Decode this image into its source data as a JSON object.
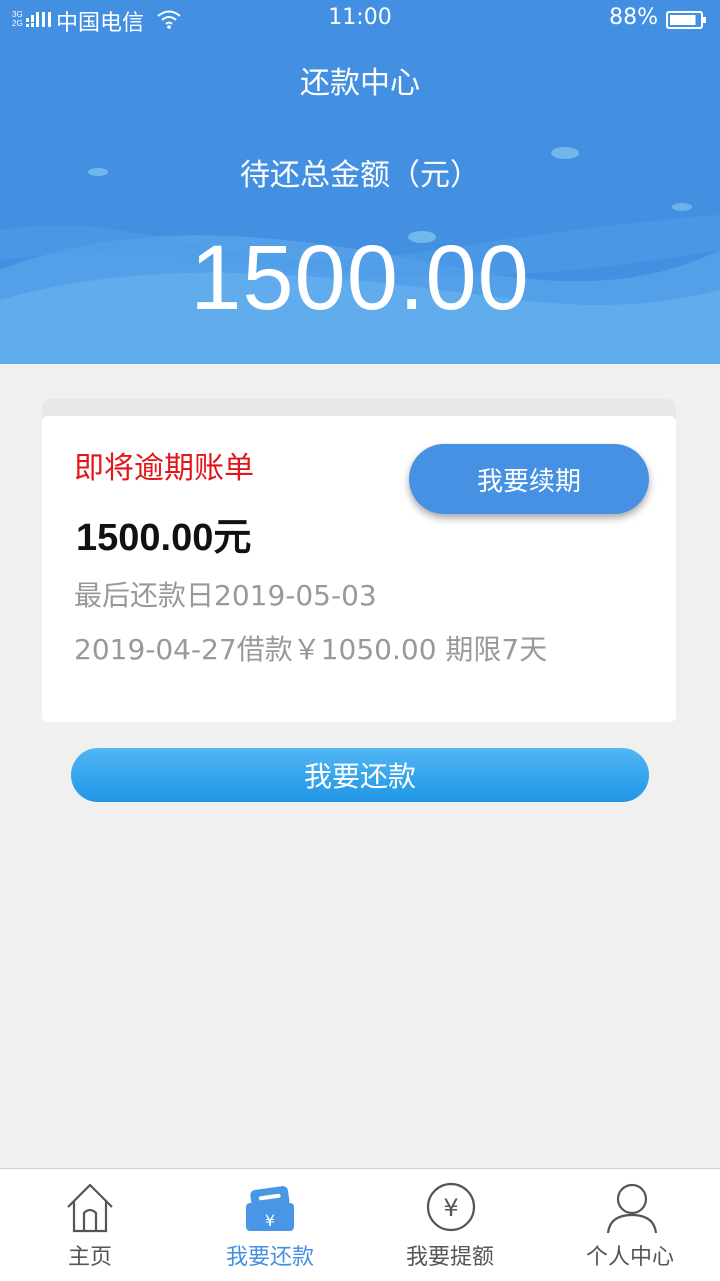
{
  "status_bar": {
    "network": "3G 2G",
    "carrier": "中国电信",
    "time": "11:00",
    "battery": "88%",
    "battery_level": 0.88
  },
  "header": {
    "title": "还款中心",
    "total_label": "待还总金额（元）",
    "total_amount": "1500.00"
  },
  "bill": {
    "title": "即将逾期账单",
    "amount": "1500.00元",
    "due_date": "最后还款日2019-05-03",
    "loan_info": "2019-04-27借款￥1050.00 期限7天",
    "renew_label": "我要续期"
  },
  "repay_label": "我要还款",
  "tabs": [
    {
      "label": "主页",
      "icon": "home-icon",
      "active": false
    },
    {
      "label": "我要还款",
      "icon": "wallet-icon",
      "active": true
    },
    {
      "label": "我要提额",
      "icon": "yen-circle-icon",
      "active": false
    },
    {
      "label": "个人中心",
      "icon": "user-icon",
      "active": false
    }
  ],
  "colors": {
    "header_blue": "#4390e3",
    "overdue_red": "#e3161b",
    "active_tab": "#4390e3"
  }
}
